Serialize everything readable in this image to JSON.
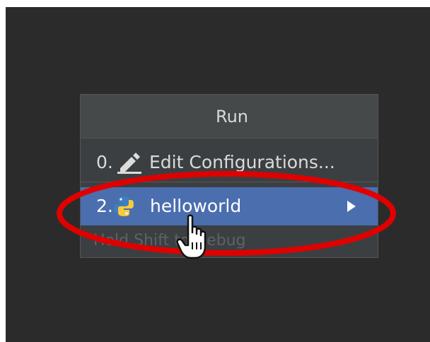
{
  "popup": {
    "title": "Run",
    "items": [
      {
        "number": "0.",
        "label": "Edit Configurations...",
        "icon": "pencil-icon"
      },
      {
        "number": "2.",
        "label": "helloworld",
        "icon": "python-icon",
        "selected": true,
        "has_submenu": true
      }
    ],
    "hint": "Hold Shift to Debug"
  },
  "colors": {
    "background": "#2b2b2b",
    "popup_background": "#3c3f41",
    "selection": "#4b6eaf",
    "annotation": "#e00000"
  },
  "overlay": {
    "annotation_shape": "red-ellipse",
    "cursor": "hand-pointer-icon"
  }
}
